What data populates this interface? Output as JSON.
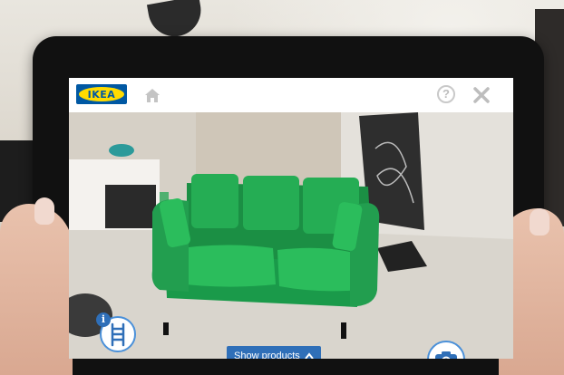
{
  "app": {
    "logo_text": "IKEA",
    "brand_colors": {
      "blue": "#0058a3",
      "yellow": "#ffdb00"
    },
    "topbar": {
      "home_icon": "home-icon",
      "help_label": "?",
      "close_icon": "close-icon"
    }
  },
  "scene": {
    "product_color": "#1fa24e",
    "product_icon": "sofa"
  },
  "controls": {
    "chair_button_icon": "chair-icon",
    "info_badge_text": "i",
    "show_products_label": "Show products",
    "show_products_icon": "chevron-up-icon",
    "camera_icon": "camera-icon",
    "accent_color": "#2f6fb8"
  }
}
